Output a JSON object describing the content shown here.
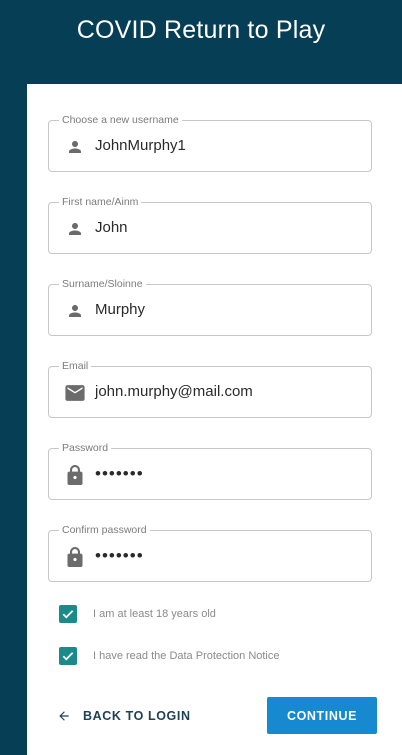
{
  "header": {
    "title": "COVID Return to Play"
  },
  "form": {
    "fields": [
      {
        "label": "Choose a new username",
        "value": "JohnMurphy1",
        "icon": "person-icon"
      },
      {
        "label": "First name/Ainm",
        "value": "John",
        "icon": "person-icon"
      },
      {
        "label": "Surname/Sloinne",
        "value": "Murphy",
        "icon": "person-icon"
      },
      {
        "label": "Email",
        "value": "john.murphy@mail.com",
        "icon": "mail-icon"
      },
      {
        "label": "Password",
        "value": "•••••••",
        "icon": "lock-icon"
      },
      {
        "label": "Confirm password",
        "value": "•••••••",
        "icon": "lock-icon"
      }
    ],
    "checkboxes": [
      {
        "label": "I am at least 18 years old",
        "checked": true
      },
      {
        "label": "I have read the Data Protection Notice",
        "checked": true
      }
    ]
  },
  "actions": {
    "back_label": "BACK TO LOGIN",
    "continue_label": "CONTINUE"
  },
  "colors": {
    "header_bg": "#063f55",
    "accent": "#1689d0",
    "checkbox": "#1a8a8a"
  }
}
